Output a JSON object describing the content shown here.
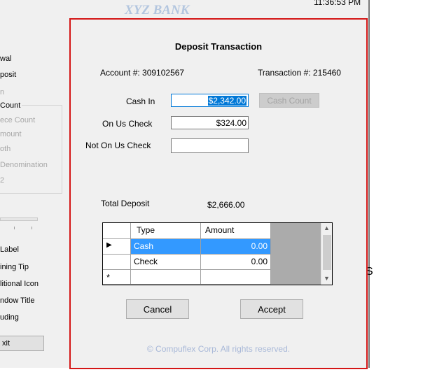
{
  "background": {
    "bank_title": "XYZ BANK",
    "clock": "11:36:53 PM",
    "left_items": [
      "wal",
      "posit",
      "n"
    ],
    "count_legend": "Count",
    "count_options": [
      "ece Count",
      "mount",
      "oth",
      "Denomination",
      "2"
    ],
    "lower_items": [
      "Label",
      "ining Tip",
      "litional Icon",
      "ndow Title",
      "uding"
    ],
    "exit_label": "xit",
    "right_glyphs": [
      "I",
      "S"
    ]
  },
  "dialog": {
    "title": "Deposit Transaction",
    "account_label": "Account #: 309102567",
    "transaction_label": "Transaction #:  215460",
    "cash_in_label": "Cash In",
    "cash_in_value": "$2,342.00",
    "cash_count_label": "Cash Count",
    "on_us_label": "On Us Check",
    "on_us_value": "$324.00",
    "not_on_us_label": "Not On Us Check",
    "not_on_us_value": "",
    "total_label": "Total Deposit",
    "total_value": "$2,666.00",
    "grid": {
      "headers": [
        "Type",
        "Amount"
      ],
      "rows": [
        {
          "type": "Cash",
          "amount": "0.00"
        },
        {
          "type": "Check",
          "amount": "0.00"
        }
      ],
      "new_row_marker": "*",
      "current_row_marker": "▶"
    },
    "cancel_label": "Cancel",
    "accept_label": "Accept",
    "copyright": "© Compuflex Corp. All rights reserved."
  },
  "colors": {
    "dialog_border": "#d41616",
    "selection": "#3399ff",
    "focus_highlight": "#0078d7",
    "bank_title": "#b3c6df",
    "copyright": "#a8b8d8"
  }
}
